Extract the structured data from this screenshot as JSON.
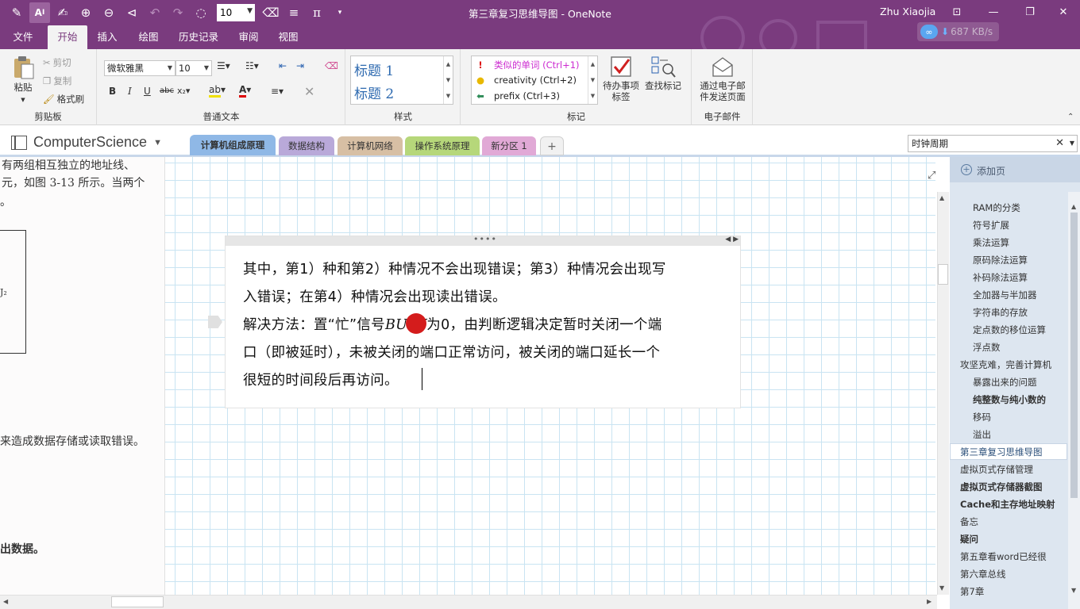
{
  "window": {
    "title": "第三章复习思维导图 - OneNote",
    "user": "Zhu Xiaojia",
    "font_size": "10",
    "net_speed": "687 KB/s"
  },
  "ribbon_tabs": [
    "文件",
    "开始",
    "插入",
    "绘图",
    "历史记录",
    "审阅",
    "视图"
  ],
  "ribbon": {
    "clipboard": {
      "paste": "粘贴",
      "cut": "剪切",
      "copy": "复制",
      "format_painter": "格式刷",
      "label": "剪贴板"
    },
    "basic_text": {
      "font": "微软雅黑",
      "size": "10",
      "bold": "B",
      "italic": "I",
      "underline": "U",
      "strike": "abc",
      "subscript": "x₂",
      "label": "普通文本"
    },
    "styles": {
      "items": [
        "标题 1",
        "标题 2"
      ],
      "label": "样式"
    },
    "tags": {
      "items": [
        {
          "label": "类似的单词 (Ctrl+1)",
          "color": "#cc2bd0"
        },
        {
          "label": "creativity (Ctrl+2)",
          "color": "#222222"
        },
        {
          "label": "prefix (Ctrl+3)",
          "color": "#222222"
        }
      ],
      "todo_line1": "待办事项",
      "todo_line2": "标签",
      "find": "查找标记",
      "label": "标记"
    },
    "email": {
      "line1": "通过电子邮",
      "line2": "件发送页面",
      "label": "电子邮件"
    }
  },
  "notebook": {
    "name": "ComputerScience",
    "sections": [
      {
        "label": "计算机组成原理",
        "color": "#8fb8e6",
        "active": true
      },
      {
        "label": "数据结构",
        "color": "#b9a9d9"
      },
      {
        "label": "计算机网络",
        "color": "#d7bfa4"
      },
      {
        "label": "操作系统原理",
        "color": "#b6d77a"
      },
      {
        "label": "新分区 1",
        "color": "#e1a9d6"
      }
    ],
    "search": "时钟周期"
  },
  "scan_text": [
    "有两组相互独立的地址线、",
    "元，如图 3-13 所示。当两个",
    "。",
    "J₂",
    "来造成数据存储或读取错误。",
    "出数据。"
  ],
  "note": {
    "line1": "其中，第1）种和第2）种情况不会出现错误；第3）种情况会出现写",
    "line2": "入错误；在第4）种情况会出现读出错误。",
    "line3_a": "解决方法：置“忙”信号",
    "line3_var": "BUSY",
    "line3_b": "为0，由判断逻辑决定暂时关闭一个端",
    "line4": "口（即被延时），未被关闭的端口正常访问，被关闭的端口延长一个",
    "line5": "很短的时间段后再访问。"
  },
  "pages": {
    "add_label": "添加页",
    "items": [
      {
        "label": "RAM的分类",
        "level": "sub"
      },
      {
        "label": "符号扩展",
        "level": "sub"
      },
      {
        "label": "乘法运算",
        "level": "sub"
      },
      {
        "label": "原码除法运算",
        "level": "sub"
      },
      {
        "label": "补码除法运算",
        "level": "sub"
      },
      {
        "label": "全加器与半加器",
        "level": "sub"
      },
      {
        "label": "字符串的存放",
        "level": "sub"
      },
      {
        "label": "定点数的移位运算",
        "level": "sub"
      },
      {
        "label": "浮点数",
        "level": "sub"
      },
      {
        "label": "攻坚克难，完善计算机",
        "level": "top"
      },
      {
        "label": "暴露出来的问题",
        "level": "sub"
      },
      {
        "label": "纯整数与纯小数的",
        "level": "sub",
        "bold": true
      },
      {
        "label": "移码",
        "level": "sub"
      },
      {
        "label": "溢出",
        "level": "sub"
      },
      {
        "label": "第三章复习思维导图",
        "level": "top",
        "selected": true
      },
      {
        "label": "虚拟页式存储管理",
        "level": "top"
      },
      {
        "label": "虚拟页式存储器截图",
        "level": "top",
        "bold": true
      },
      {
        "label": "Cache和主存地址映射",
        "level": "top",
        "bold": true
      },
      {
        "label": "备忘",
        "level": "top"
      },
      {
        "label": "疑问",
        "level": "top",
        "bold": true
      },
      {
        "label": "第五章看word已经很",
        "level": "top"
      },
      {
        "label": "第六章总线",
        "level": "top"
      },
      {
        "label": "第7章",
        "level": "top"
      }
    ]
  },
  "icons": [
    "pen-icon",
    "text-select-icon",
    "draw-icon",
    "zoom-in-icon",
    "zoom-out-icon",
    "back-icon",
    "undo-icon",
    "redo-icon",
    "lasso-icon",
    "eraser-icon",
    "lines-icon",
    "pi-icon"
  ]
}
